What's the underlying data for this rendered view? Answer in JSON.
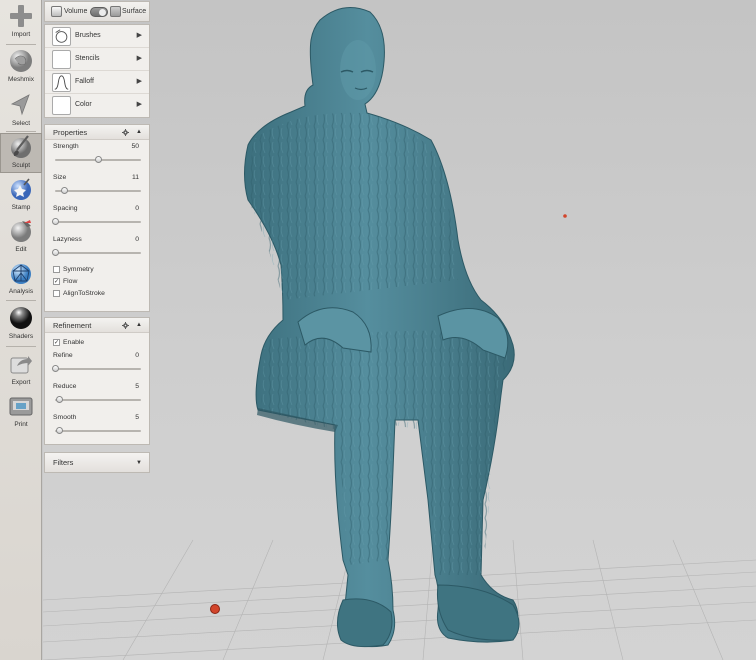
{
  "toolbar": {
    "items": [
      {
        "label": "Import",
        "icon": "plus-icon",
        "active": false
      },
      {
        "label": "Meshmix",
        "icon": "meshmix-icon",
        "active": false
      },
      {
        "label": "Select",
        "icon": "select-arrow-icon",
        "active": false
      },
      {
        "label": "Sculpt",
        "icon": "sculpt-brush-icon",
        "active": true
      },
      {
        "label": "Stamp",
        "icon": "stamp-icon",
        "active": false
      },
      {
        "label": "Edit",
        "icon": "edit-icon",
        "active": false
      },
      {
        "label": "Analysis",
        "icon": "analysis-icon",
        "active": false
      },
      {
        "label": "Shaders",
        "icon": "shaders-sphere-icon",
        "active": false
      },
      {
        "label": "Export",
        "icon": "export-icon",
        "active": false
      },
      {
        "label": "Print",
        "icon": "print-icon",
        "active": false
      }
    ]
  },
  "mode": {
    "volume_label": "Volume",
    "surface_label": "Surface"
  },
  "library": {
    "rows": [
      {
        "label": "Brushes",
        "icon": "brush-tip-icon"
      },
      {
        "label": "Stencils",
        "icon": "blank-thumb-icon"
      },
      {
        "label": "Falloff",
        "icon": "falloff-curve-icon"
      },
      {
        "label": "Color",
        "icon": "blank-thumb-icon"
      }
    ]
  },
  "properties": {
    "title": "Properties",
    "sliders": [
      {
        "label": "Strength",
        "value": "50",
        "level": 0.5
      },
      {
        "label": "Size",
        "value": "11",
        "level": 0.1
      },
      {
        "label": "Spacing",
        "value": "0",
        "level": 0.0
      },
      {
        "label": "Lazyness",
        "value": "0",
        "level": 0.0
      }
    ],
    "checks": [
      {
        "label": "Symmetry",
        "checked": false
      },
      {
        "label": "Flow",
        "checked": true
      },
      {
        "label": "AlignToStroke",
        "checked": false
      }
    ]
  },
  "refinement": {
    "title": "Refinement",
    "enable_label": "Enable",
    "enable_checked": true,
    "sliders": [
      {
        "label": "Refine",
        "value": "0",
        "level": 0.0
      },
      {
        "label": "Reduce",
        "value": "5",
        "level": 0.05
      },
      {
        "label": "Smooth",
        "value": "5",
        "level": 0.05
      }
    ]
  },
  "filters": {
    "title": "Filters"
  },
  "colors": {
    "model": "#4f8898",
    "model_dark": "#2f5f6c",
    "background": "#c9c9c9",
    "panel": "#f1efec",
    "pivot": "#d2452b"
  }
}
